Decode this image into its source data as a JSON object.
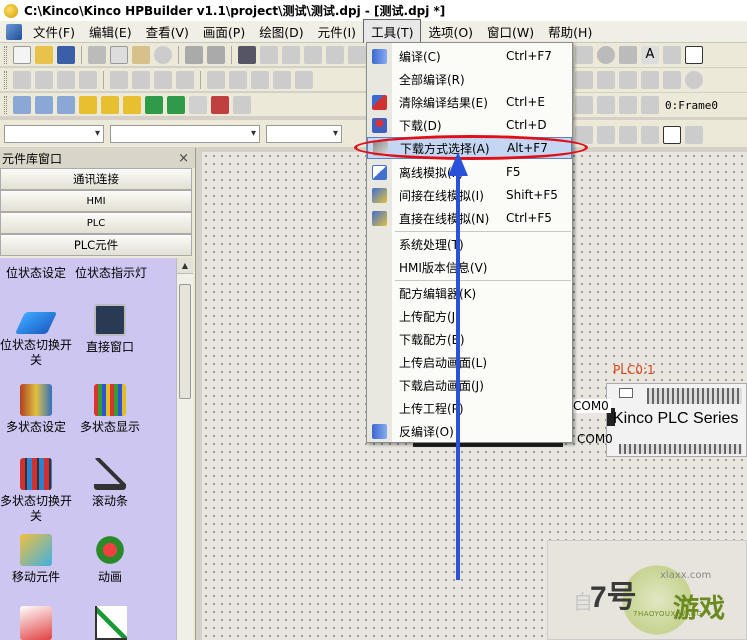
{
  "window": {
    "title": "C:\\Kinco\\Kinco HPBuilder v1.1\\project\\测试\\测试.dpj - [测试.dpj *]"
  },
  "menubar": {
    "items": [
      "文件(F)",
      "编辑(E)",
      "查看(V)",
      "画面(P)",
      "绘图(D)",
      "元件(I)",
      "工具(T)",
      "选项(O)",
      "窗口(W)",
      "帮助(H)"
    ],
    "active_index": 6
  },
  "toolbar": {
    "frame_label": "0:Frame0"
  },
  "tools_menu": {
    "items": [
      {
        "label": "编译(C)",
        "shortcut": "Ctrl+F7",
        "icon": "compile-icon"
      },
      {
        "label": "全部编译(R)",
        "shortcut": "",
        "icon": ""
      },
      {
        "label": "清除编译结果(E)",
        "shortcut": "Ctrl+E",
        "icon": "clear-icon"
      },
      {
        "label": "下载(D)",
        "shortcut": "Ctrl+D",
        "icon": "download-icon"
      },
      {
        "label": "下载方式选择(A)",
        "shortcut": "Alt+F7",
        "icon": "download-mode-icon"
      },
      {
        "label": "离线模拟(F)",
        "shortcut": "F5",
        "icon": "offline-sim-icon"
      },
      {
        "label": "间接在线模拟(I)",
        "shortcut": "Shift+F5",
        "icon": "indirect-sim-icon"
      },
      {
        "label": "直接在线模拟(N)",
        "shortcut": "Ctrl+F5",
        "icon": "direct-sim-icon"
      },
      {
        "label": "系统处理(T)",
        "shortcut": "",
        "icon": ""
      },
      {
        "label": "HMI版本信息(V)",
        "shortcut": "",
        "icon": ""
      },
      {
        "label": "配方编辑器(K)",
        "shortcut": "",
        "icon": ""
      },
      {
        "label": "上传配方(J)",
        "shortcut": "",
        "icon": ""
      },
      {
        "label": "下载配方(B)",
        "shortcut": "",
        "icon": ""
      },
      {
        "label": "上传启动画面(L)",
        "shortcut": "",
        "icon": ""
      },
      {
        "label": "下载启动画面(J)",
        "shortcut": "",
        "icon": ""
      },
      {
        "label": "上传工程(P)",
        "shortcut": "",
        "icon": ""
      },
      {
        "label": "反编译(O)",
        "shortcut": "",
        "icon": "decompile-icon"
      }
    ],
    "highlighted_index": 4
  },
  "library_panel": {
    "title": "元件库窗口",
    "categories": [
      "通讯连接",
      "HMI",
      "PLC",
      "PLC元件"
    ],
    "palette": [
      {
        "label": "位状态设定",
        "icon": "bit-state-set-icon"
      },
      {
        "label": "位状态指示灯",
        "icon": "bit-state-lamp-icon"
      },
      {
        "label": "位状态切换开关",
        "icon": "bit-state-switch-icon"
      },
      {
        "label": "直接窗口",
        "icon": "direct-window-icon"
      },
      {
        "label": "多状态设定",
        "icon": "multi-state-set-icon"
      },
      {
        "label": "多状态显示",
        "icon": "multi-state-display-icon"
      },
      {
        "label": "多状态切换开关",
        "icon": "multi-state-switch-icon"
      },
      {
        "label": "滚动条",
        "icon": "scrollbar-icon"
      },
      {
        "label": "移动元件",
        "icon": "move-element-icon"
      },
      {
        "label": "动画",
        "icon": "animation-icon"
      }
    ]
  },
  "canvas": {
    "plc_label": "PLC0:1",
    "plc_text": "Kinco PLC Series",
    "com_top": "COM0",
    "com_bottom": "COM0"
  },
  "watermark": {
    "number": "7号",
    "text": "游戏",
    "url": "xlaxx.com",
    "sub": "7HAOYOUXIWANG",
    "faint": "自"
  },
  "colors": {
    "highlight": "#c5d6f2",
    "annotation_red": "#e0101a",
    "annotation_blue": "#2a52d8",
    "palette_bg": "#ccc6f0"
  }
}
